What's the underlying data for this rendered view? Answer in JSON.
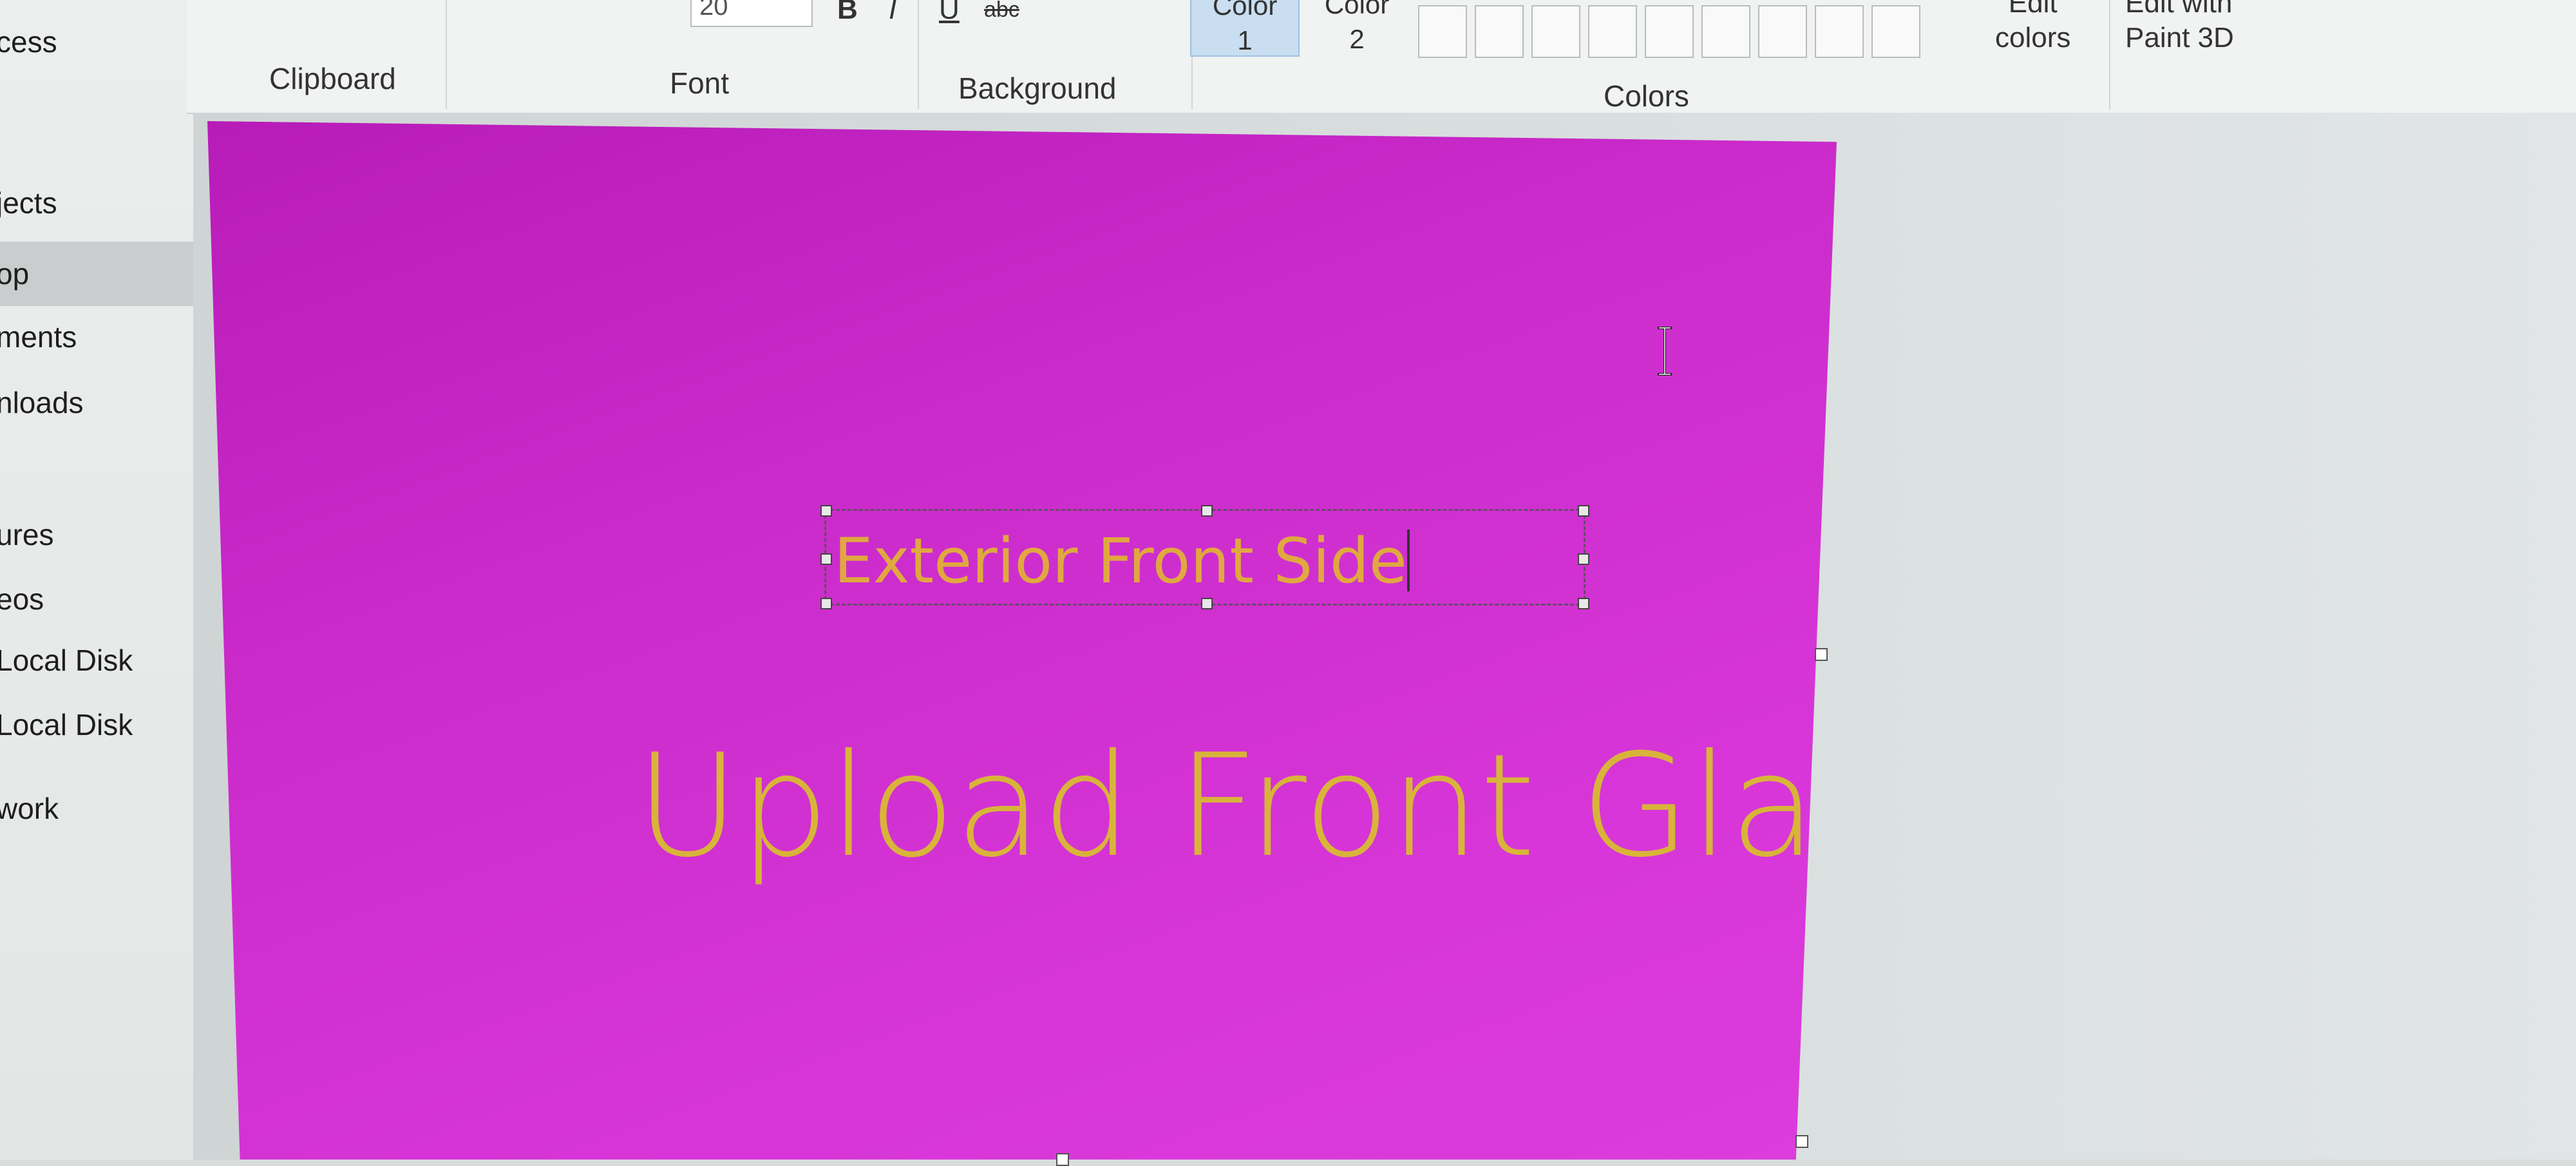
{
  "sidebar": {
    "items": [
      {
        "label": "cess",
        "selected": false
      },
      {
        "label": "jects",
        "selected": false
      },
      {
        "label": "op",
        "selected": true
      },
      {
        "label": "ments",
        "selected": false
      },
      {
        "label": "nloads",
        "selected": false
      },
      {
        "label": "ures",
        "selected": false
      },
      {
        "label": "eos",
        "selected": false
      },
      {
        "label": " Local Disk",
        "selected": false
      },
      {
        "label": " Local Disk",
        "selected": false
      },
      {
        "label": "work",
        "selected": false
      }
    ]
  },
  "ribbon": {
    "groups": {
      "clipboard": "Clipboard",
      "font": "Font",
      "background": "Background",
      "colors": "Colors"
    },
    "font_size": "20",
    "format_buttons": {
      "bold": "B",
      "italic": "I",
      "underline": "U",
      "strikethrough": "abc"
    },
    "color1": {
      "line1": "Color",
      "line2": "1"
    },
    "color2": {
      "line1": "Color",
      "line2": "2"
    },
    "edit_colors": {
      "line1": "Edit",
      "line2": "colors"
    },
    "edit_paint3d": {
      "line1": "Edit with",
      "line2": "Paint 3D"
    }
  },
  "canvas": {
    "background_color": "#d230d2",
    "text_box_value": "Exterior Front Side",
    "big_text": "Upload Front Glass",
    "text_color": "#e0a840"
  }
}
